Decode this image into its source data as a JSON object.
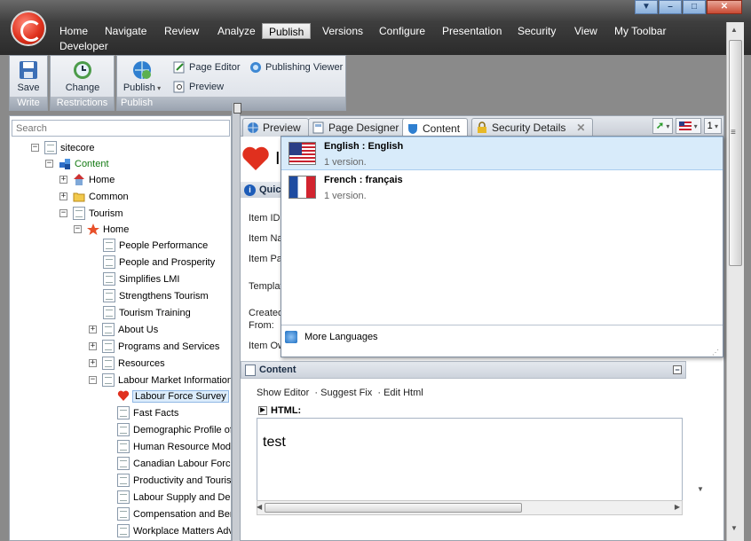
{
  "menu": {
    "items": [
      "Home",
      "Navigate",
      "Review",
      "Analyze",
      "Publish",
      "Versions",
      "Configure",
      "Presentation",
      "Security",
      "View",
      "My Toolbar",
      "Developer"
    ],
    "active": "Publish"
  },
  "ribbon": {
    "write": {
      "group": "Write",
      "save": "Save"
    },
    "restrictions": {
      "group": "Restrictions",
      "change": "Change"
    },
    "publish": {
      "group": "Publish",
      "publish": "Publish",
      "page_editor": "Page Editor",
      "publishing_viewer": "Publishing Viewer",
      "preview": "Preview"
    }
  },
  "tree": {
    "search_placeholder": "Search",
    "nodes": {
      "sitecore": "sitecore",
      "content": "Content",
      "home": "Home",
      "common": "Common",
      "tourism": "Tourism",
      "tourism_home": "Home",
      "people_performance": "People Performance",
      "people_prosperity": "People and Prosperity",
      "simplifies_lmi": "Simplifies LMI",
      "strengthens_tourism": "Strengthens Tourism",
      "tourism_training": "Tourism Training",
      "about_us": "About Us",
      "programs_services": "Programs and Services",
      "resources": "Resources",
      "labour_market_info": "Labour Market Information",
      "labour_force_survey": "Labour Force Survey",
      "fast_facts": "Fast Facts",
      "demographic_profile": "Demographic Profile of",
      "human_resource": "Human Resource Modu",
      "canadian_labour": "Canadian Labour Force",
      "productivity": "Productivity and Touris",
      "labour_supply": "Labour Supply and Der",
      "compensation": "Compensation and Ber",
      "workplace_matters": "Workplace Matters Adv"
    }
  },
  "tabs": [
    {
      "label": "Preview"
    },
    {
      "label": "Page Designer"
    },
    {
      "label": "Content"
    },
    {
      "label": "Security Details"
    }
  ],
  "tab_tools": {
    "version": "1"
  },
  "item": {
    "title_initial": "I",
    "quick_info": "Quick",
    "fields": [
      "Item ID",
      "Item Na",
      "Item Pa",
      "Templat",
      "Created",
      "From:",
      "Item Ow"
    ]
  },
  "languages": [
    {
      "name": "English : English",
      "versions": "1 version.",
      "flag": "us"
    },
    {
      "name": "French : français",
      "versions": "1 version.",
      "flag": "fr"
    }
  ],
  "more_languages": "More Languages",
  "content_section": {
    "title": "Content",
    "actions": [
      "Show Editor",
      "Suggest Fix",
      "Edit Html"
    ],
    "html_label": "HTML:",
    "html_value": "test"
  }
}
